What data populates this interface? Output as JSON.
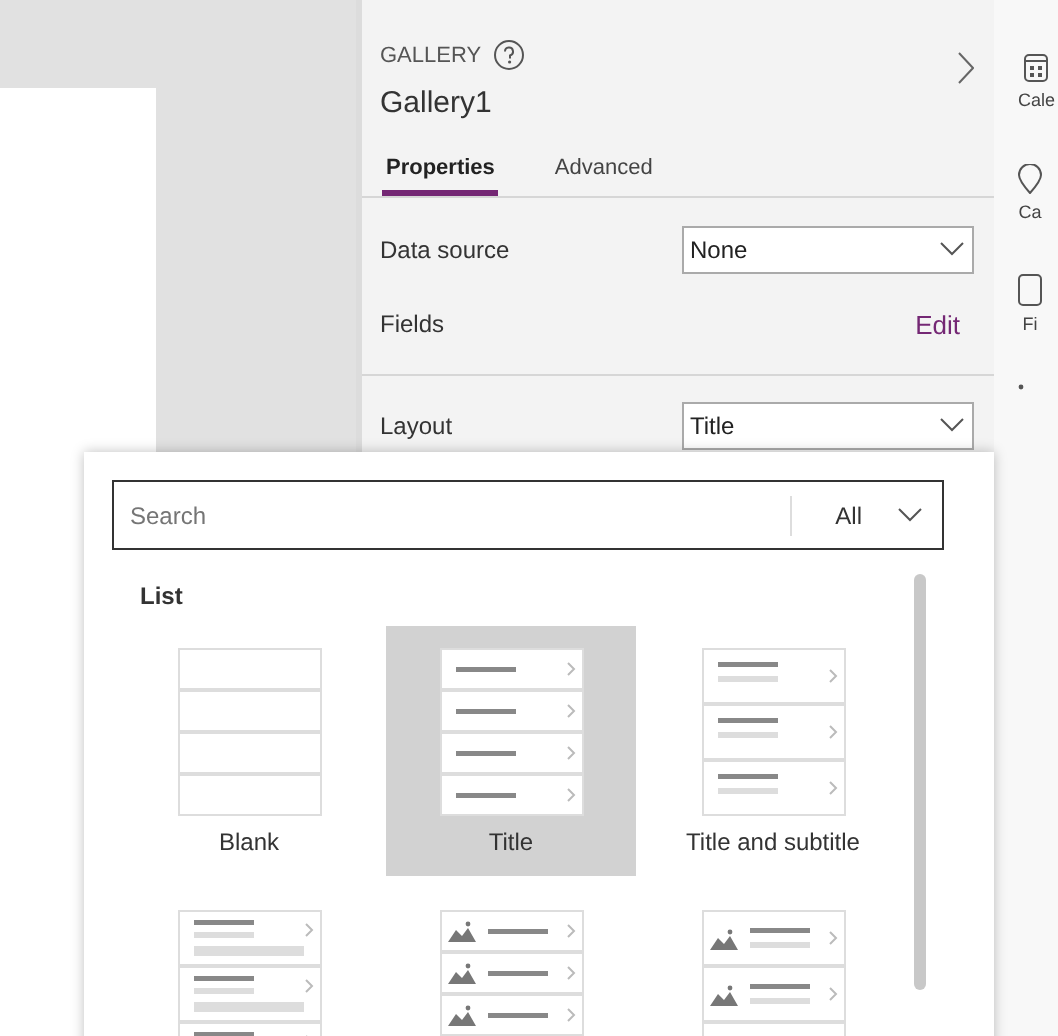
{
  "panel": {
    "type_label": "GALLERY",
    "name": "Gallery1",
    "tabs": [
      {
        "label": "Properties",
        "selected": true
      },
      {
        "label": "Advanced",
        "selected": false
      }
    ],
    "data_source": {
      "label": "Data source",
      "value": "None"
    },
    "fields": {
      "label": "Fields",
      "action": "Edit"
    },
    "layout": {
      "label": "Layout",
      "value": "Title"
    }
  },
  "side_strip": [
    {
      "kind": "calendar",
      "label": "Cale"
    },
    {
      "kind": "pin",
      "label": "Ca"
    },
    {
      "kind": "form",
      "label": "Fi"
    },
    {
      "kind": "more"
    }
  ],
  "layout_picker": {
    "search": {
      "placeholder": "Search"
    },
    "filter": "All",
    "section": "List",
    "items": [
      {
        "kind": "blank",
        "label": "Blank",
        "selected": false
      },
      {
        "kind": "title",
        "label": "Title",
        "selected": true
      },
      {
        "kind": "title-subtitle",
        "label": "Title and subtitle",
        "selected": false
      },
      {
        "kind": "title-subtitle-body",
        "selected": false
      },
      {
        "kind": "image-title",
        "selected": false
      },
      {
        "kind": "image-title-subtitle",
        "selected": false
      }
    ]
  }
}
